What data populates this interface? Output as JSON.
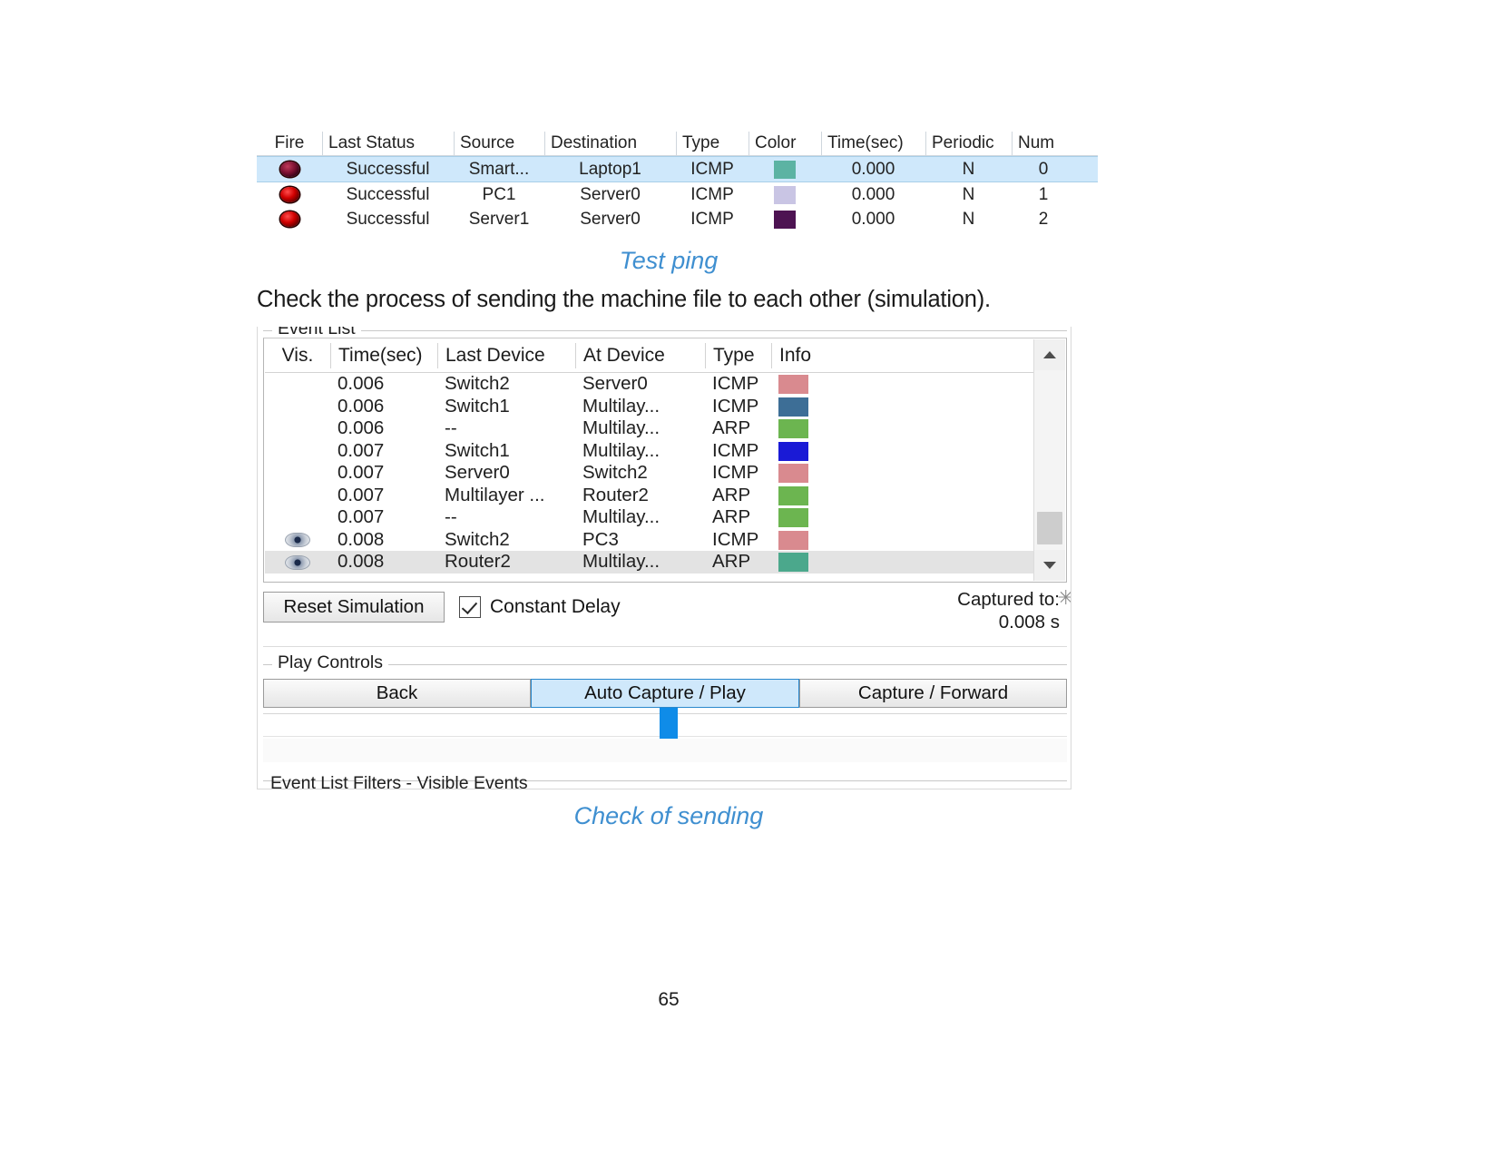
{
  "pdu_table": {
    "columns": [
      "Fire",
      "Last Status",
      "Source",
      "Destination",
      "Type",
      "Color",
      "Time(sec)",
      "Periodic",
      "Num"
    ],
    "rows": [
      {
        "fire": "fire-led-icon",
        "status": "Successful",
        "source": "Smart...",
        "destination": "Laptop1",
        "type": "ICMP",
        "color": "#5cb3a3",
        "time": "0.000",
        "periodic": "N",
        "num": "0",
        "selected": true
      },
      {
        "fire": "fire-led-icon",
        "status": "Successful",
        "source": "PC1",
        "destination": "Server0",
        "type": "ICMP",
        "color": "#c9c5e4",
        "time": "0.000",
        "periodic": "N",
        "num": "1",
        "selected": false
      },
      {
        "fire": "fire-led-icon",
        "status": "Successful",
        "source": "Server1",
        "destination": "Server0",
        "type": "ICMP",
        "color": "#4d1352",
        "time": "0.000",
        "periodic": "N",
        "num": "2",
        "selected": false
      }
    ]
  },
  "caption_1": "Test ping",
  "body_text": "Check the process of sending the machine file to each other (simulation).",
  "caption_2": "Check of sending",
  "event_list": {
    "group_title": "Event List",
    "columns": [
      "Vis.",
      "Time(sec)",
      "Last Device",
      "At Device",
      "Type",
      "Info"
    ],
    "rows": [
      {
        "vis": "",
        "time": "0.006",
        "last_device": "Switch2",
        "at_device": "Server0",
        "type": "ICMP",
        "info_color": "#d98a8f",
        "highlight": false
      },
      {
        "vis": "",
        "time": "0.006",
        "last_device": "Switch1",
        "at_device": "Multilay...",
        "type": "ICMP",
        "info_color": "#3d6e96",
        "highlight": false
      },
      {
        "vis": "",
        "time": "0.006",
        "last_device": "--",
        "at_device": "Multilay...",
        "type": "ARP",
        "info_color": "#6cb550",
        "highlight": false
      },
      {
        "vis": "",
        "time": "0.007",
        "last_device": "Switch1",
        "at_device": "Multilay...",
        "type": "ICMP",
        "info_color": "#1a1ad6",
        "highlight": false
      },
      {
        "vis": "",
        "time": "0.007",
        "last_device": "Server0",
        "at_device": "Switch2",
        "type": "ICMP",
        "info_color": "#d98a8f",
        "highlight": false
      },
      {
        "vis": "",
        "time": "0.007",
        "last_device": "Multilayer ...",
        "at_device": "Router2",
        "type": "ARP",
        "info_color": "#6cb550",
        "highlight": false
      },
      {
        "vis": "",
        "time": "0.007",
        "last_device": "--",
        "at_device": "Multilay...",
        "type": "ARP",
        "info_color": "#6cb550",
        "highlight": false
      },
      {
        "vis": "eye-icon",
        "time": "0.008",
        "last_device": "Switch2",
        "at_device": "PC3",
        "type": "ICMP",
        "info_color": "#d98a8f",
        "highlight": false
      },
      {
        "vis": "eye-icon",
        "time": "0.008",
        "last_device": "Router2",
        "at_device": "Multilay...",
        "type": "ARP",
        "info_color": "#4ba88c",
        "highlight": true
      }
    ]
  },
  "controls": {
    "reset_label": "Reset Simulation",
    "constant_delay_label": "Constant Delay",
    "constant_delay_checked": true,
    "captured_to_label": "Captured to:",
    "captured_to_value": "0.008 s"
  },
  "play_controls": {
    "group_title": "Play Controls",
    "back_label": "Back",
    "auto_label": "Auto Capture / Play",
    "forward_label": "Capture / Forward"
  },
  "filters": {
    "label": "Event List Filters - Visible Events"
  },
  "page_number": "65"
}
